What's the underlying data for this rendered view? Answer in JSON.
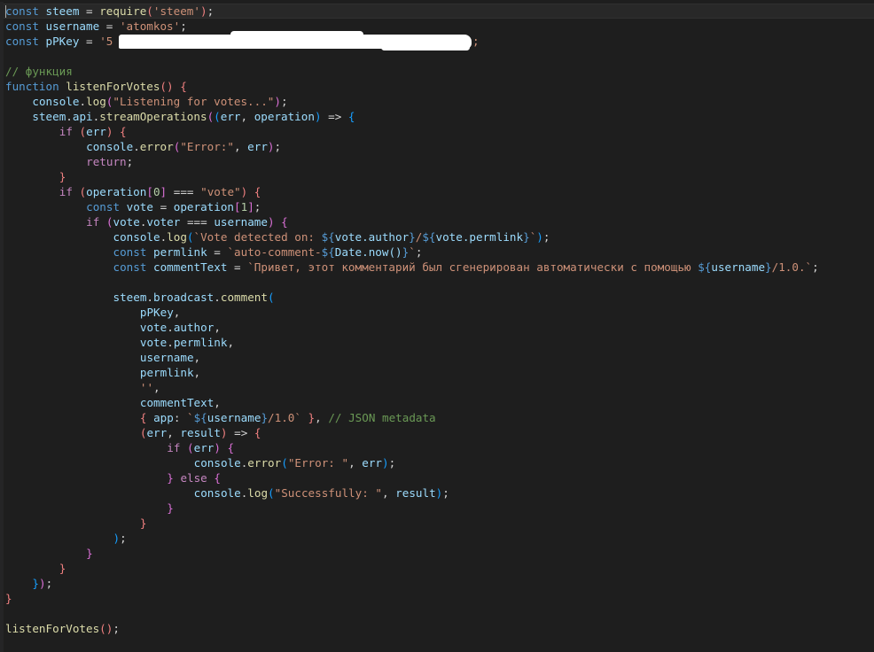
{
  "editor": {
    "language": "javascript",
    "lines": [
      "const steem = require('steem');",
      "const username = 'atomkos';",
      "const pPKey = '5",
      "",
      "// функция",
      "function listenForVotes() {",
      "    console.log(\"Listening for votes...\");",
      "    steem.api.streamOperations((err, operation) => {",
      "        if (err) {",
      "            console.error(\"Error:\", err);",
      "            return;",
      "        }",
      "        if (operation[0] === \"vote\") {",
      "            const vote = operation[1];",
      "            if (vote.voter === username) {",
      "                console.log(`Vote detected on: ${vote.author}/${vote.permlink}`);",
      "                const permlink = `auto-comment-${Date.now()}`;",
      "                const commentText = `Привет, этот комментарий был сгенерирован автоматически с помощью ${username}/1.0.`;",
      "",
      "                steem.broadcast.comment(",
      "                    pPKey,",
      "                    vote.author,",
      "                    vote.permlink,",
      "                    username,",
      "                    permlink,",
      "                    '',",
      "                    commentText,",
      "                    { app: `${username}/1.0` }, // JSON metadata",
      "                    (err, result) => {",
      "                        if (err) {",
      "                            console.error(\"Error: \", err);",
      "                        } else {",
      "                            console.log(\"Successfully: \", result);",
      "                        }",
      "                    }",
      "                );",
      "            }",
      "        }",
      "    });",
      "}",
      "",
      "listenForVotes();"
    ],
    "redacted_tail": "';"
  },
  "colors": {
    "background": "#1e1e1e",
    "keyword": "#569cd6",
    "control": "#c586c0",
    "string": "#ce9178",
    "comment": "#6a9955",
    "function": "#dcdcaa",
    "variable": "#9cdcfe",
    "text": "#d4d4d4"
  }
}
